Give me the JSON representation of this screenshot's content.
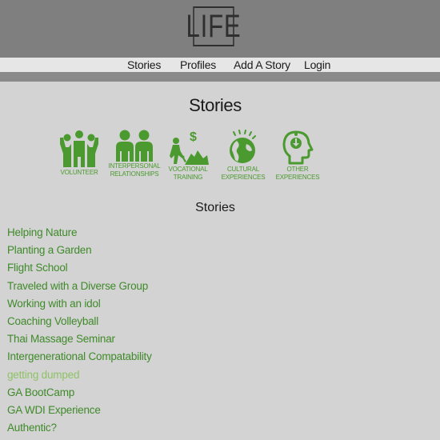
{
  "header": {
    "logo_text": "LIFE"
  },
  "nav": {
    "items": [
      {
        "label": "Stories"
      },
      {
        "label": "Profiles"
      },
      {
        "label": "Add A Story"
      },
      {
        "label": "Login"
      }
    ]
  },
  "page": {
    "title": "Stories",
    "section_title": "Stories"
  },
  "categories": [
    {
      "label": "VOLUNTEER",
      "icon": "volunteer-icon"
    },
    {
      "label": "INTERPERSONAL\nRELATIONSHIPS",
      "icon": "relationships-icon"
    },
    {
      "label": "VOCATIONAL\nTRAINING",
      "icon": "vocational-icon"
    },
    {
      "label": "CULTURAL\nEXPERIENCES",
      "icon": "globe-icon"
    },
    {
      "label": "OTHER\nEXPERIENCES",
      "icon": "head-icon"
    }
  ],
  "stories": [
    {
      "title": "Helping Nature"
    },
    {
      "title": "Planting a Garden"
    },
    {
      "title": "Flight School"
    },
    {
      "title": "Traveled with a Diverse Group"
    },
    {
      "title": "Working with an idol"
    },
    {
      "title": "Coaching Volleyball"
    },
    {
      "title": "Thai Massage Seminar"
    },
    {
      "title": "Intergenerational Compatability"
    },
    {
      "title": "getting dumped"
    },
    {
      "title": "GA BootCamp"
    },
    {
      "title": "GA WDI Experience"
    },
    {
      "title": "Authentic?"
    }
  ],
  "colors": {
    "accent_green": "#4b9a2f",
    "link_green": "#3f8a2a",
    "visited_link_green": "#8fc266",
    "header_gray": "#7f7f7f",
    "background": "#d3d3d3"
  }
}
